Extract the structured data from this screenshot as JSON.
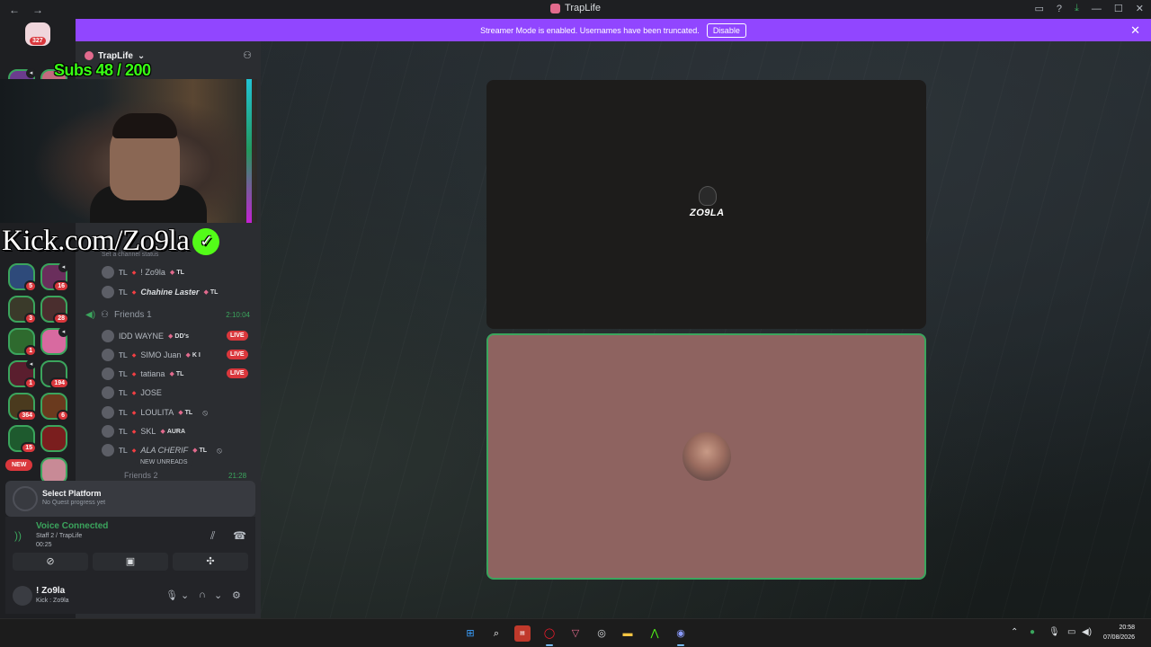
{
  "window": {
    "title": "TrapLife"
  },
  "banner": {
    "message": "Streamer Mode is enabled. Usernames have been truncated.",
    "disable_label": "Disable"
  },
  "rail": {
    "home_badge": "327",
    "new_label": "NEW",
    "servers": [
      {
        "badge": ""
      },
      {
        "badge": ""
      },
      {
        "badge": "5"
      },
      {
        "badge": "16"
      },
      {
        "badge": "3"
      },
      {
        "badge": "28"
      },
      {
        "badge": "1"
      },
      {
        "badge": ""
      },
      {
        "badge": "1"
      },
      {
        "badge": "194"
      },
      {
        "badge": "364"
      },
      {
        "badge": "6"
      },
      {
        "badge": "15"
      },
      {
        "badge": ""
      }
    ]
  },
  "server": {
    "name": "TrapLife"
  },
  "overlay": {
    "subs": "Subs 48 / 200",
    "kick_url": "Kick.com/Zo9la"
  },
  "channel": {
    "status_placeholder": "Set a channel status",
    "members_top": [
      {
        "prefix": "TL",
        "name": "! Zo9la",
        "tag": "TL"
      },
      {
        "prefix": "TL",
        "name": "Chahine Laster",
        "tag": "TL"
      }
    ]
  },
  "voice_channel": {
    "name": "Friends 1",
    "duration": "2:10:04",
    "members": [
      {
        "prefix": "",
        "name": "IDD WAYNE",
        "tag": "DD's",
        "live": "LIVE"
      },
      {
        "prefix": "TL",
        "name": "SIMO Juan",
        "tag": "K I",
        "live": "LIVE"
      },
      {
        "prefix": "TL",
        "name": "tatiana",
        "tag": "TL",
        "live": "LIVE"
      },
      {
        "prefix": "TL",
        "name": "JOSE",
        "tag": "",
        "live": ""
      },
      {
        "prefix": "TL",
        "name": "LOULITA",
        "tag": "TL",
        "live": ""
      },
      {
        "prefix": "TL",
        "name": "SKL",
        "tag": "AURA",
        "live": ""
      },
      {
        "prefix": "TL",
        "name": "ALA CHERIF",
        "tag": "TL",
        "live": ""
      }
    ],
    "new_unreads": "NEW UNREADS",
    "next_channel": "Friends 2",
    "next_duration": "21:28"
  },
  "quest": {
    "title": "Select Platform",
    "subtitle": "No Quest progress yet"
  },
  "voice": {
    "status": "Voice Connected",
    "location": "Staff 2 / TrapLife",
    "elapsed": "00:25"
  },
  "user": {
    "name": "! Zo9la",
    "status": "Kick : Zo9la"
  },
  "stage": {
    "tile1_logo_text": "ZO9LA"
  },
  "taskbar": {
    "time": "20:58",
    "date": "07/08/2026"
  },
  "colors": {
    "accent_purple": "#9146ff",
    "online_green": "#3ba55d",
    "live_red": "#da373c",
    "kick_green": "#53fc18",
    "subs_green": "#39ff14"
  }
}
